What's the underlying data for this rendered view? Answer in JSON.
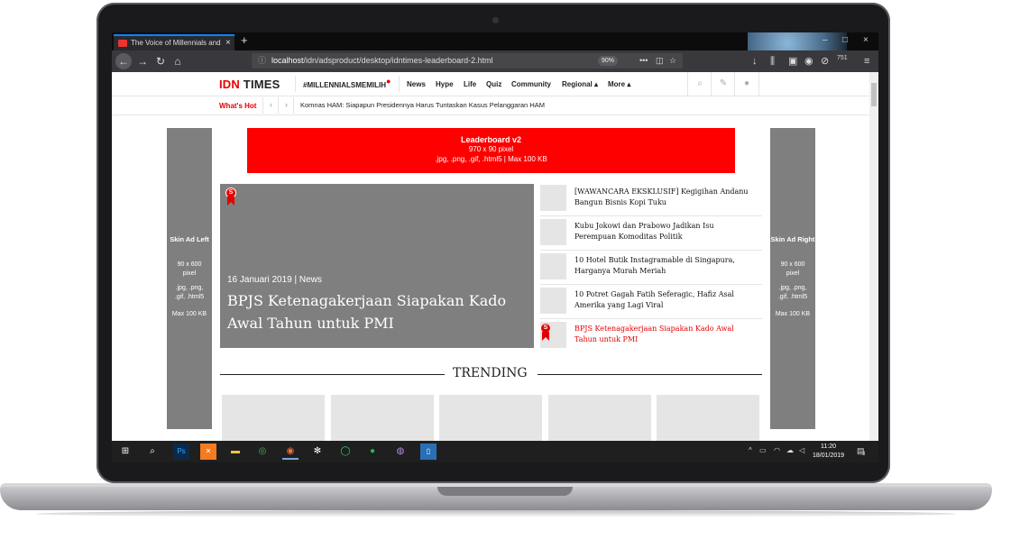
{
  "browser": {
    "tab_title": "The Voice of Millennials and Gen Z",
    "tab_close": "×",
    "new_tab": "+",
    "url_prefix": "localhost",
    "url_path": "/idn/adsproduct/desktop/idntimes-leaderboard-2.html",
    "zoom": "90%",
    "back": "←",
    "forward": "→",
    "reload": "↻",
    "home": "⌂",
    "window_min": "–",
    "window_max": "□",
    "window_close": "×",
    "menu": "≡",
    "badge_count": "751"
  },
  "site": {
    "logo_idn": "IDN",
    "logo_times": " TIMES",
    "hashtag": "#MILLENNIALSMEMILIH",
    "nav": [
      "News",
      "Hype",
      "Life",
      "Quiz",
      "Community",
      "Regional ▴",
      "More ▴"
    ],
    "whats_hot_label": "What's Hot",
    "whats_hot_news": "Komnas HAM: Siapapun Presidennya Harus Tuntaskan Kasus Pelanggaran HAM"
  },
  "ads": {
    "leaderboard": {
      "title": "Leaderboard v2",
      "size": "970 x 90 pixel",
      "formats": ".jpg, .png, .gif, .html5 | Max 100 KB"
    },
    "skin_left": {
      "title": "Skin Ad Left",
      "size_1": "90 x 600",
      "size_2": "pixel",
      "formats_1": ".jpg, .png,",
      "formats_2": ".gif, .html5",
      "max": "Max 100 KB"
    },
    "skin_right": {
      "title": "Skin Ad Right",
      "size_1": "90 x 600",
      "size_2": "pixel",
      "formats_1": ".jpg, .png,",
      "formats_2": ".gif, .html5",
      "max": "Max 100 KB"
    }
  },
  "hero": {
    "badge": "S",
    "date": "16 Januari 2019 | News",
    "title": "BPJS Ketenagakerjaan Siapakan Kado Awal Tahun untuk PMI"
  },
  "list": [
    {
      "title": "[WAWANCARA EKSKLUSIF] Kegigihan Andanu Bangun Bisnis Kopi Tuku"
    },
    {
      "title": "Kubu Jokowi dan Prabowo Jadikan Isu Perempuan Komoditas Politik"
    },
    {
      "title": "10 Hotel Butik Instagramable di Singapura, Harganya Murah Meriah"
    },
    {
      "title": "10 Potret Gagah Fatih Seferagic, Hafiz Asal Amerika yang Lagi Viral"
    },
    {
      "title": "BPJS Ketenagakerjaan Siapakan Kado Awal Tahun untuk PMI"
    }
  ],
  "trending_label": "TRENDING",
  "taskbar": {
    "time": "11:20",
    "date": "18/01/2019",
    "notif_count": "3"
  },
  "colors": {
    "brand_red": "#e40000",
    "ad_red": "#ff0000",
    "placeholder_gray": "#7f7f7f"
  }
}
